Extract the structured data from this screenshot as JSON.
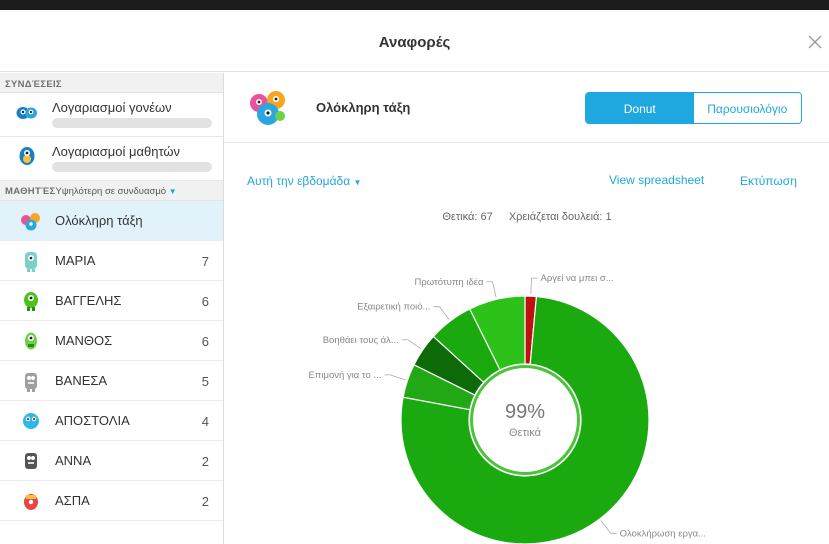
{
  "modal": {
    "title": "Αναφορές"
  },
  "sidebar": {
    "connections_title": "ΣΥΝΔΈΣΕΙΣ",
    "connections": [
      {
        "label": "Λογαριασμοί γονέων",
        "icon": "parents-monster-icon"
      },
      {
        "label": "Λογαριασμοί μαθητών",
        "icon": "student-monster-icon"
      }
    ],
    "students_title": "ΜΑΘΗΤΈΣ",
    "students_sort": "Υψηλότερη σε συνδυασμό",
    "class_row_label": "Ολόκληρη τάξη",
    "students": [
      {
        "name": "ΜΑΡΙΑ",
        "score": "7",
        "color": "#7ad1c8",
        "color2": "#ffffff"
      },
      {
        "name": "ΒΑΓΓΕΛΗΣ",
        "score": "6",
        "color": "#4cc31d",
        "color2": "#2e8a10"
      },
      {
        "name": "ΜΑΝΘΟΣ",
        "score": "6",
        "color": "#6bd04a",
        "color2": "#ffffff"
      },
      {
        "name": "ΒΑΝΕΣΑ",
        "score": "5",
        "color": "#a0a0a0",
        "color2": "#ffffff"
      },
      {
        "name": "ΑΠΟΣΤΟΛΙΑ",
        "score": "4",
        "color": "#2fb8e6",
        "color2": "#ffffff"
      },
      {
        "name": "ΑΝΝΑ",
        "score": "2",
        "color": "#555555",
        "color2": "#ffffff"
      },
      {
        "name": "ΑΣΠΑ",
        "score": "2",
        "color": "#e84545",
        "color2": "#ffffff"
      }
    ]
  },
  "content": {
    "class_name": "Ολόκληρη τάξη",
    "toggle": {
      "active": "Donut",
      "inactive": "Παρουσιολόγιο"
    },
    "period": "Αυτή την εβδομάδα",
    "view_spreadsheet": "View spreadsheet",
    "print": "Εκτύπωση",
    "summary": {
      "positive_label": "Θετικά:",
      "positive_value": "67",
      "needs_work_label": "Χρειάζεται δουλειά:",
      "needs_work_value": "1"
    }
  },
  "colors": {
    "accent": "#1fa8e0",
    "positive": "#1aa90f",
    "negative": "#b40f0f"
  },
  "chart_data": {
    "type": "pie",
    "variant": "donut",
    "center_value": "99%",
    "center_label": "Θετικά",
    "slices": [
      {
        "label": "Αργεί να μπει σ...",
        "value": 1,
        "color": "#c0110f"
      },
      {
        "label": "Ολοκλήρωση εργα...",
        "value": 52,
        "color": "#1aa90f"
      },
      {
        "label": "Επιμονή για το ...",
        "value": 3,
        "color": "#22a815"
      },
      {
        "label": "Βοηθάει τους άλ...",
        "value": 3,
        "color": "#0d6a08"
      },
      {
        "label": "Εξαιρετική ποιό...",
        "value": 4,
        "color": "#1aa90f"
      },
      {
        "label": "Πρωτότυπη ιδέα",
        "value": 5,
        "color": "#2cc21a"
      }
    ]
  }
}
